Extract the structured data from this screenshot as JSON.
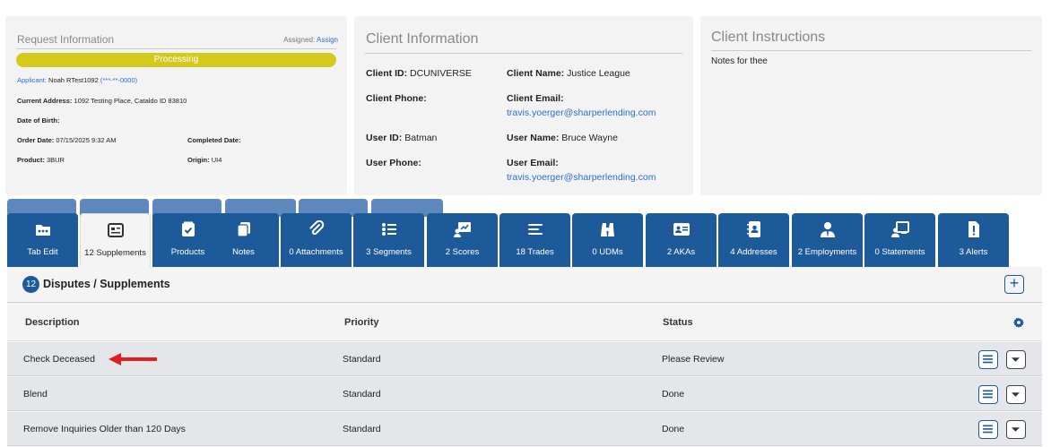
{
  "request": {
    "title": "Request Information",
    "assigned_label": "Assigned:",
    "assign_link": "Assign",
    "status": "Processing",
    "applicant_label": "Applicant:",
    "applicant_name": "Noah RTest1092",
    "applicant_ssn": "(***-**-0000)",
    "address_label": "Current Address:",
    "address": "1092 Testing Place, Cataldo ID 83810",
    "dob_label": "Date of Birth:",
    "order_date_label": "Order Date:",
    "order_date": "07/15/2025 9:32 AM",
    "completed_label": "Completed Date:",
    "product_label": "Product:",
    "product": "3BUR",
    "origin_label": "Origin:",
    "origin": "UI4"
  },
  "client": {
    "title": "Client Information",
    "client_id_label": "Client ID:",
    "client_id": "DCUNIVERSE",
    "client_name_label": "Client Name:",
    "client_name": "Justice League",
    "client_phone_label": "Client Phone:",
    "client_email_label": "Client Email:",
    "client_email": "travis.yoerger@sharperlending.com",
    "user_id_label": "User ID:",
    "user_id": "Batman",
    "user_name_label": "User Name:",
    "user_name": "Bruce Wayne",
    "user_phone_label": "User Phone:",
    "user_email_label": "User Email:",
    "user_email": "travis.yoerger@sharperlending.com"
  },
  "instructions": {
    "title": "Client Instructions",
    "notes": "Notes for thee"
  },
  "tabs": [
    {
      "label": "Tab Edit",
      "icon": "dots-icon"
    },
    {
      "label": "12 Supplements",
      "icon": "id-card-icon"
    },
    {
      "label": "Products",
      "icon": "box-check-icon"
    },
    {
      "label": "Notes",
      "icon": "copy-icon"
    },
    {
      "label": "0 Attachments",
      "icon": "paperclip-icon"
    },
    {
      "label": "3 Segments",
      "icon": "list-icon"
    },
    {
      "label": "2 Scores",
      "icon": "chart-board-icon"
    },
    {
      "label": "18 Trades",
      "icon": "lines-icon"
    },
    {
      "label": "0 UDMs",
      "icon": "binoculars-icon"
    },
    {
      "label": "2 AKAs",
      "icon": "address-card-icon"
    },
    {
      "label": "4 Addresses",
      "icon": "address-book-icon"
    },
    {
      "label": "2 Employments",
      "icon": "user-tie-icon"
    },
    {
      "label": "0 Statements",
      "icon": "chalkboard-user-icon"
    },
    {
      "label": "3 Alerts",
      "icon": "file-alert-icon"
    }
  ],
  "panel": {
    "count": "12",
    "title": "Disputes / Supplements",
    "headers": {
      "description": "Description",
      "priority": "Priority",
      "status": "Status"
    },
    "rows": [
      {
        "description": "Check Deceased",
        "priority": "Standard",
        "status": "Please Review"
      },
      {
        "description": "Blend",
        "priority": "Standard",
        "status": "Done"
      },
      {
        "description": "Remove Inquiries Older than 120 Days",
        "priority": "Standard",
        "status": "Done"
      }
    ]
  },
  "colors": {
    "tab_blue": "#1d5a9a",
    "status_yellow": "#d4c91c",
    "link_blue": "#2a6fd6",
    "arrow_red": "#e02020"
  }
}
